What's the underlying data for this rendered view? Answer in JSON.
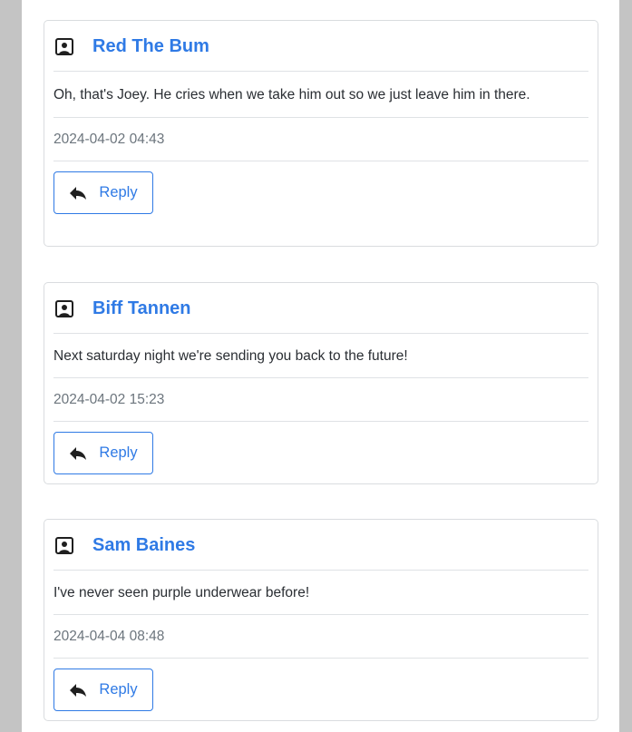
{
  "comments": [
    {
      "author": "Red The Bum",
      "text": "Oh, that's Joey. He cries when we take him out so we just leave him in there.",
      "date": "2024-04-02 04:43",
      "reply_label": "Reply"
    },
    {
      "author": "Biff Tannen",
      "text": "Next saturday night we're sending you back to the future!",
      "date": "2024-04-02 15:23",
      "reply_label": "Reply"
    },
    {
      "author": "Sam Baines",
      "text": "I've never seen purple underwear before!",
      "date": "2024-04-04 08:48",
      "reply_label": "Reply"
    }
  ],
  "icons": {
    "author": "user-portrait-icon",
    "reply": "reply-arrow-icon"
  },
  "colors": {
    "accent": "#2f7ae5",
    "text": "#2a2e33",
    "muted": "#6c757d",
    "border": "#d9dcdf",
    "background": "#c4c4c4",
    "panel": "#ffffff"
  }
}
